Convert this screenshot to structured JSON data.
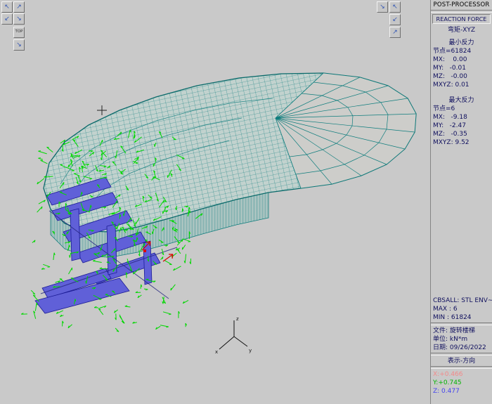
{
  "view_controls": {
    "top_left": {
      "up_left": "↖",
      "up_right": "↗",
      "down_left": "↙",
      "down_right": "↘",
      "top_view_label": "TOP",
      "extra": "↘"
    },
    "top_right": {
      "a": "↘",
      "b": "↖",
      "c": "↙",
      "d": "↗"
    }
  },
  "panel": {
    "title": "POST-PROCESSOR",
    "mode": "REACTION FORCE",
    "component": "弯矩-XYZ",
    "min": {
      "heading": "最小反力",
      "node": "节点=61824",
      "mx": "MX:    0.00",
      "my": "MY:   -0.01",
      "mz": "MZ:   -0.00",
      "mxyz": "MXYZ: 0.01"
    },
    "max": {
      "heading": "最大反力",
      "node": "节点=6",
      "mx": "MX:   -9.18",
      "my": "MY:   -2.47",
      "mz": "MZ:   -0.35",
      "mxyz": "MXYZ: 9.52"
    },
    "result": {
      "case": "CBSALL: STL ENV~",
      "max": "MAX : 6",
      "min": "MIN : 61824"
    },
    "info": {
      "file": "文件: 旋转楼梯",
      "unit": "单位: kN*m",
      "date": "日期: 09/26/2022"
    },
    "direction": {
      "heading": "表示-方向",
      "x": "X:+0.466",
      "y": "Y:+0.745",
      "z": "Z: 0.477",
      "x_color": "#f28a8a",
      "y_color": "#00b400",
      "z_color": "#4444ee"
    }
  },
  "colors": {
    "mesh": "#0e7d7d",
    "reaction_arrows": "#00d800",
    "plate_elements": "#6060d8",
    "background": "#c9c9c9"
  }
}
